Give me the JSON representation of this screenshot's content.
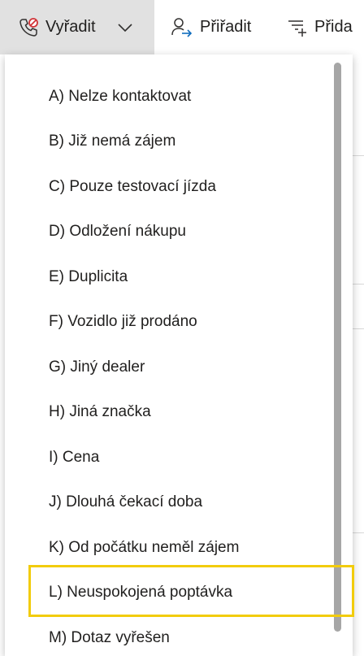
{
  "toolbar": {
    "disqualify_label": "Vyřadit",
    "assign_label": "Přiřadit",
    "add_label": "Přida"
  },
  "dropdown": {
    "items": [
      {
        "label": "A) Nelze kontaktovat"
      },
      {
        "label": "B) Již nemá zájem"
      },
      {
        "label": "C) Pouze testovací jízda"
      },
      {
        "label": "D) Odložení nákupu"
      },
      {
        "label": "E) Duplicita"
      },
      {
        "label": "F) Vozidlo již prodáno"
      },
      {
        "label": "G) Jiný dealer"
      },
      {
        "label": "H) Jiná značka"
      },
      {
        "label": "I) Cena"
      },
      {
        "label": "J) Dlouhá čekací doba"
      },
      {
        "label": "K) Od počátku neměl zájem"
      },
      {
        "label": "L) Neuspokojená poptávka"
      },
      {
        "label": "M) Dotaz vyřešen"
      }
    ],
    "highlighted_item": "L) Neuspokojená poptávka"
  },
  "colors": {
    "active_button_bg": "#e1e1e1",
    "highlight_border": "#f2cc0c",
    "disqualify_icon_accent": "#d13438",
    "scrollbar": "#a6a6a6"
  },
  "icons": {
    "disqualify": "phone-blocked-icon",
    "dropdown_chevron": "chevron-down-icon",
    "assign": "person-arrow-icon",
    "add": "add-list-icon"
  }
}
